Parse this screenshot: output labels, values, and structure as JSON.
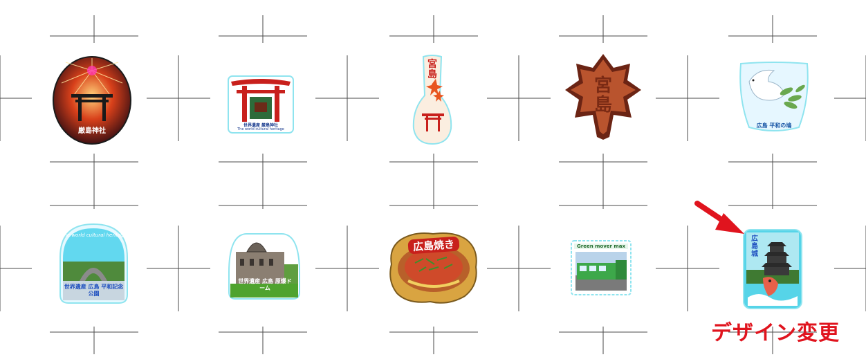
{
  "colors": {
    "crop_mark": "#4a4a4a",
    "accent_red": "#e0141e",
    "torii_red": "#c8201c",
    "outline_cyan": "#8fe4ef"
  },
  "stickers": [
    {
      "id": "itsukushima-fireworks",
      "icon": "torii-fireworks-icon",
      "caption": "厳島神社"
    },
    {
      "id": "torii-heritage",
      "icon": "torii-gate-icon",
      "caption": "世界遺産 厳島神社",
      "subcaption": "The world cultural heritage"
    },
    {
      "id": "miyajima-spatula",
      "icon": "rice-scoop-icon",
      "caption": "宮島"
    },
    {
      "id": "momiji-manju",
      "icon": "maple-leaf-icon",
      "caption": "宮島"
    },
    {
      "id": "peace-dove",
      "icon": "dove-icon",
      "caption": "広島 平和の鳩"
    },
    {
      "id": "peace-memorial-park",
      "icon": "cenotaph-icon",
      "caption": "世界遺産 広島 平和記念公園",
      "arc_text": "The world cultural heritage"
    },
    {
      "id": "atomic-bomb-dome",
      "icon": "dome-icon",
      "caption": "世界遺産 広島 原爆ドーム"
    },
    {
      "id": "okonomiyaki",
      "icon": "okonomiyaki-icon",
      "caption": "広島焼き"
    },
    {
      "id": "green-mover-tram",
      "icon": "tram-icon",
      "caption": "Green mover max"
    },
    {
      "id": "hiroshima-castle",
      "icon": "castle-icon",
      "caption": "広島城"
    }
  ],
  "annotation": {
    "label": "デザイン変更",
    "arrow": "red-arrow-icon"
  }
}
